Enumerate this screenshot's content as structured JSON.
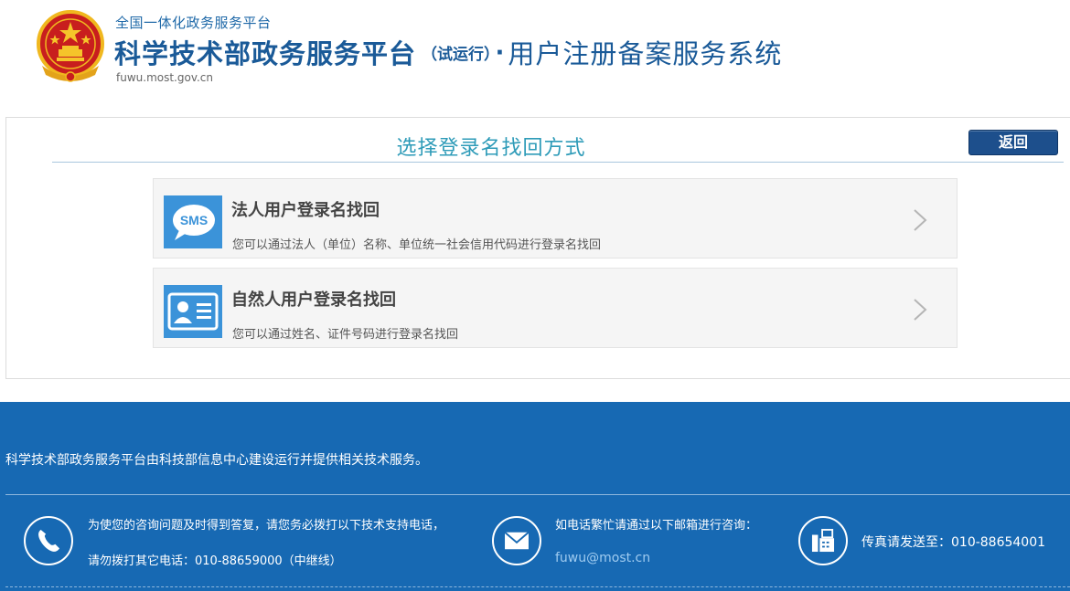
{
  "header": {
    "platform_label": "全国一体化政务服务平台",
    "title_main": "科学技术部政务服务平台",
    "title_trial": "（试运行）",
    "title_dot": "·",
    "title_system": "用户注册备案服务系统",
    "domain": "fuwu.most.gov.cn",
    "emblem_icon": "national-emblem-icon"
  },
  "panel": {
    "title": "选择登录名找回方式",
    "back_label": "返回",
    "options": [
      {
        "title": "法人用户登录名找回",
        "description": "您可以通过法人（单位）名称、单位统一社会信用代码进行登录名找回",
        "icon": "sms-icon",
        "icon_text": "SMS"
      },
      {
        "title": "自然人用户登录名找回",
        "description": "您可以通过姓名、证件号码进行登录名找回",
        "icon": "id-card-icon"
      }
    ]
  },
  "footer": {
    "statement": "科学技术部政务服务平台由科技部信息中心建设运行并提供相关技术服务。",
    "tech_support_line1": "为使您的咨询问题及时得到答复，请您务必拨打以下技术支持电话，",
    "tech_support_line2": "请勿拨打其它电话：010-88659000（中继线）",
    "mail_line1": "如电话繁忙请通过以下邮箱进行咨询：",
    "mail_address": "fuwu@most.cn",
    "fax": "传真请发送至：010-88654001"
  },
  "colors": {
    "brand_blue": "#1a5a98",
    "title_teal": "#2e9bb8",
    "footer_blue": "#1769b3",
    "icon_blue": "#3b93d9",
    "button_navy": "#1d4f8c"
  }
}
